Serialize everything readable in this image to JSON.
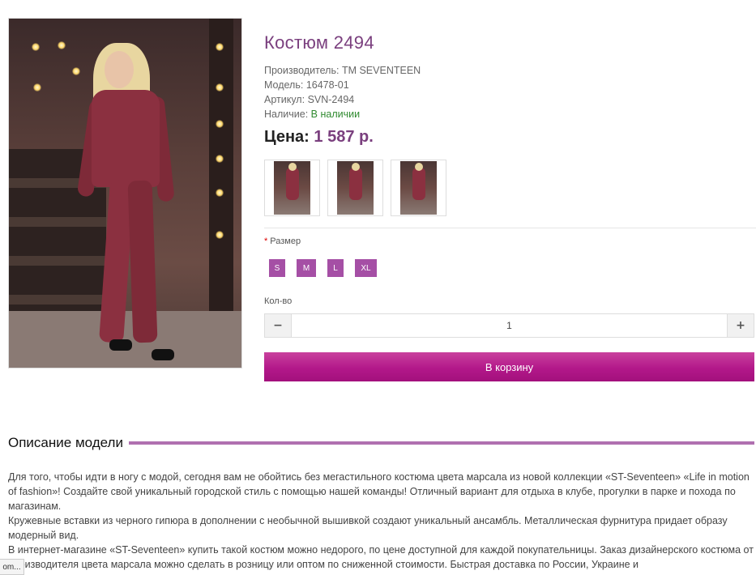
{
  "product": {
    "title": "Костюм 2494",
    "manufacturer_label": "Производитель:",
    "manufacturer": "TM SEVENTEEN",
    "model_label": "Модель:",
    "model": "16478-01",
    "sku_label": "Артикул:",
    "sku": "SVN-2494",
    "availability_label": "Наличие:",
    "availability": "В наличии",
    "price_label": "Цена:",
    "price": "1 587 р."
  },
  "options": {
    "size_required_mark": "*",
    "size_label": "Размер",
    "sizes": [
      "S",
      "M",
      "L",
      "XL"
    ],
    "qty_label": "Кол-во",
    "qty_value": "1",
    "qty_minus": "−",
    "qty_plus": "+"
  },
  "cart_button": "В корзину",
  "description": {
    "heading": "Описание модели",
    "p1": "Для того, чтобы идти в ногу с модой, сегодня вам не обойтись без мегастильного костюма цвета марсала из новой коллекции «ST-Seventeen» «Life in motion of fashion»! Создайте свой уникальный городской стиль с помощью нашей команды! Отличный вариант для отдыха в клубе, прогулки в парке и похода по магазинам.",
    "p2": "Кружевные вставки из черного гипюра в дополнении с необычной вышивкой создают уникальный ансамбль. Металлическая фурнитура придает образу модерный вид.",
    "p3": "В интернет-магазине «ST-Seventeen» купить такой костюм можно недорого, по цене доступной для каждой покупательницы. Заказ дизайнерского костюма от производителя цвета марсала можно сделать в розницу или оптом по сниженной стоимости. Быстрая доставка по России, Украине и"
  },
  "tooltip_tab": "om..."
}
